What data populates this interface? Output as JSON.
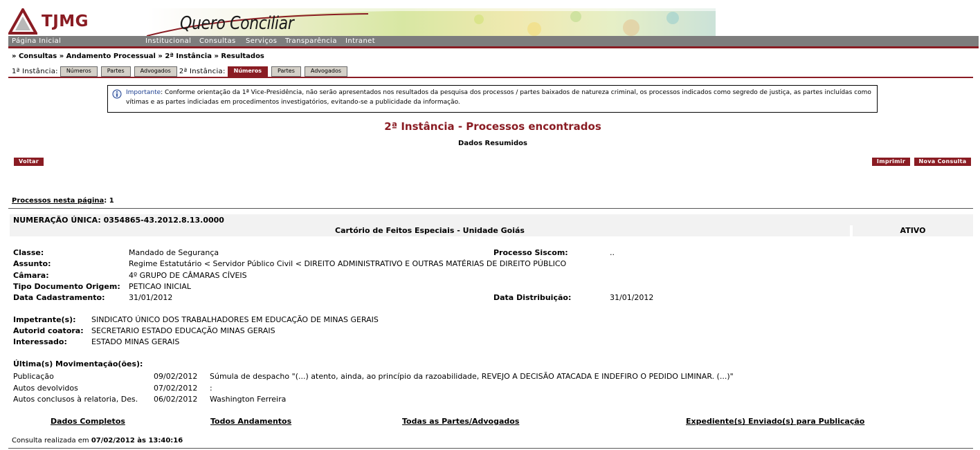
{
  "header": {
    "logo_text": "TJMG",
    "banner_title": "Quero Conciliar"
  },
  "menu": {
    "home": "Página Inicial",
    "items": [
      "Institucional",
      "Consultas",
      "Serviços",
      "Transparência",
      "Intranet"
    ]
  },
  "breadcrumb": "» Consultas » Andamento Processual » 2ª Instância » Resultados",
  "tabs": {
    "first_label": "1ª Instância:",
    "first": [
      "Números",
      "Partes",
      "Advogados"
    ],
    "second_label": "2ª Instância:",
    "second": [
      "Números",
      "Partes",
      "Advogados"
    ],
    "active": "second-0"
  },
  "notice": {
    "bold": "Importante",
    "text": ": Conforme orientação da 1ª Vice-Presidência, não serão apresentados nos resultados da pesquisa dos processos / partes baixados de natureza criminal, os processos indicados como segredo de justiça, as partes incluídas como vítimas e as partes indiciadas em procedimentos investigatórios, evitando-se a publicidade da informação."
  },
  "page": {
    "title": "2ª Instância - Processos encontrados",
    "subtitle": "Dados Resumidos"
  },
  "buttons": {
    "back": "Voltar",
    "print": "Imprimir",
    "new_query": "Nova Consulta"
  },
  "results": {
    "count_label": "Processos nesta página",
    "count_value": ": 1"
  },
  "process": {
    "numeracao": "NUMERAÇÃO ÚNICA: 0354865-43.2012.8.13.0000",
    "cartorio": "Cartório de Feitos Especiais - Unidade Goiás",
    "status": "ATIVO",
    "fields": {
      "classe_label": "Classe:",
      "classe": "Mandado de Segurança",
      "siscom_label": "Processo Siscom:",
      "siscom": "..",
      "assunto_label": "Assunto:",
      "assunto": "Regime Estatutário < Servidor Público Civil < DIREITO ADMINISTRATIVO E OUTRAS MATÉRIAS DE DIREITO PÚBLICO",
      "camara_label": "Câmara:",
      "camara": "4º GRUPO DE CÂMARAS CÍVEIS",
      "tipo_doc_label": "Tipo Documento Origem:",
      "tipo_doc": "PETICAO INICIAL",
      "data_cad_label": "Data Cadastramento:",
      "data_cad": "31/01/2012",
      "data_dist_label": "Data Distribuição:",
      "data_dist": "31/01/2012"
    },
    "parties": [
      {
        "label": "Impetrante(s):",
        "value": "SINDICATO ÚNICO DOS TRABALHADORES EM EDUCAÇÃO DE MINAS GERAIS"
      },
      {
        "label": "Autorid coatora:",
        "value": "SECRETARIO ESTADO EDUCAÇÃO MINAS GERAIS"
      },
      {
        "label": "Interessado:",
        "value": "ESTADO MINAS GERAIS"
      }
    ],
    "movements_title": "Última(s) Movimentação(ões):",
    "movements": [
      {
        "type": "Publicação",
        "date": "09/02/2012",
        "desc": "Súmula de despacho \"(...) atento, ainda, ao princípio da razoabilidade, REVEJO A DECISÃO ATACADA E INDEFIRO O PEDIDO LIMINAR. (...)\""
      },
      {
        "type": "Autos devolvidos",
        "date": "07/02/2012",
        "desc": ":"
      },
      {
        "type": "Autos conclusos à relatoria, Des.",
        "date": "06/02/2012",
        "desc": "Washington Ferreira"
      }
    ]
  },
  "links": {
    "complete": "Dados Completos",
    "all_moves": "Todos Andamentos",
    "all_parties": "Todas as Partes/Advogados",
    "expedientes": "Expediente(s) Enviado(s) para Publicação"
  },
  "footer": {
    "prefix": "Consulta realizada em ",
    "timestamp": "07/02/2012 às 13:40:16"
  },
  "colors": {
    "brand": "#8a1c23",
    "menu": "#7d7d7d",
    "tab_inactive": "#d4d0c8"
  }
}
